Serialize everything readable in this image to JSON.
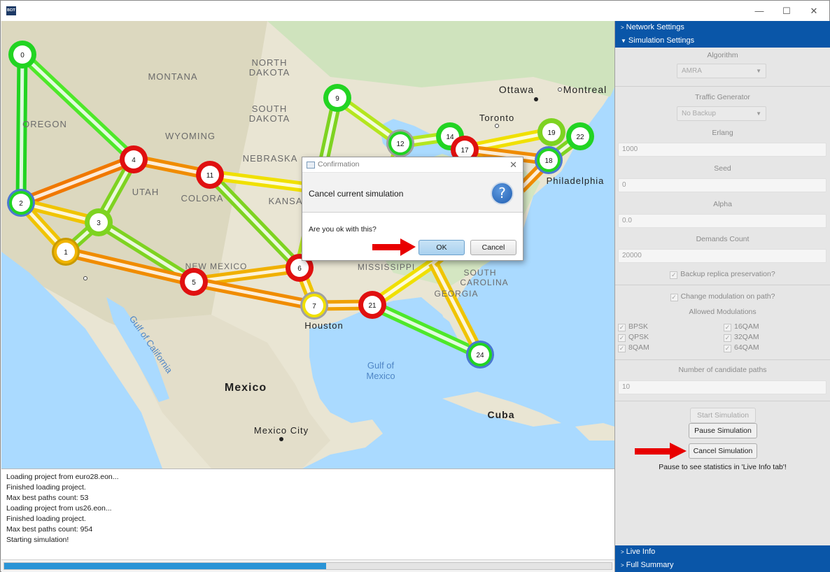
{
  "window": {
    "app_icon_text": "BCIT",
    "minimize": "—",
    "maximize": "☐",
    "close": "✕"
  },
  "map": {
    "place_labels": [
      {
        "text": "NORTH",
        "kind": "state"
      },
      {
        "text": "DAKOTA",
        "kind": "state"
      },
      {
        "text": "MONTANA",
        "kind": "state"
      },
      {
        "text": "SOUTH",
        "kind": "state"
      },
      {
        "text": "DAKOTA",
        "kind": "state"
      },
      {
        "text": "WYOMING",
        "kind": "state"
      },
      {
        "text": "OREGON",
        "kind": "state"
      },
      {
        "text": "NEBRASKA",
        "kind": "state"
      },
      {
        "text": "UTAH",
        "kind": "state"
      },
      {
        "text": "COLORA",
        "kind": "state"
      },
      {
        "text": "KANSA",
        "kind": "state"
      },
      {
        "text": "NEW MEXICO",
        "kind": "state"
      },
      {
        "text": "MISSISSIPPI",
        "kind": "state"
      },
      {
        "text": "SOUTH",
        "kind": "state"
      },
      {
        "text": "CAROLINA",
        "kind": "state"
      },
      {
        "text": "GEORGIA",
        "kind": "state"
      },
      {
        "text": "Ottawa",
        "kind": "city"
      },
      {
        "text": "Montreal",
        "kind": "city"
      },
      {
        "text": "Toronto",
        "kind": "city"
      },
      {
        "text": "Philadelphia",
        "kind": "city"
      },
      {
        "text": "Houston",
        "kind": "city"
      },
      {
        "text": "Mexico",
        "kind": "country"
      },
      {
        "text": "Mexico City",
        "kind": "city"
      },
      {
        "text": "Cuba",
        "kind": "country"
      },
      {
        "text": "Gulf of",
        "kind": "water"
      },
      {
        "text": "Mexico",
        "kind": "water"
      },
      {
        "text": "Gulf of California",
        "kind": "water"
      }
    ],
    "nodes": [
      {
        "id": "0",
        "ring": "#22d422"
      },
      {
        "id": "1",
        "ring": "#f0b400"
      },
      {
        "id": "2",
        "ring": "#22d422"
      },
      {
        "id": "3",
        "ring": "#7ed321"
      },
      {
        "id": "4",
        "ring": "#e01010"
      },
      {
        "id": "5",
        "ring": "#e01010"
      },
      {
        "id": "6",
        "ring": "#e01010"
      },
      {
        "id": "7",
        "ring": "#f0e000"
      },
      {
        "id": "9",
        "ring": "#22d422"
      },
      {
        "id": "11",
        "ring": "#e01010"
      },
      {
        "id": "12",
        "ring": "#22d422"
      },
      {
        "id": "14",
        "ring": "#22d422"
      },
      {
        "id": "17",
        "ring": "#e01010"
      },
      {
        "id": "18",
        "ring": "#22d422"
      },
      {
        "id": "19",
        "ring": "#7ed321"
      },
      {
        "id": "21",
        "ring": "#e01010"
      },
      {
        "id": "22",
        "ring": "#22d422"
      },
      {
        "id": "24",
        "ring": "#22d422"
      }
    ]
  },
  "log": {
    "lines": [
      "Loading project from euro28.eon...",
      "Finished loading project.",
      "Max best paths count: 53",
      "Loading project from us26.eon...",
      "Finished loading project.",
      "Max best paths count: 954",
      "Starting simulation!"
    ]
  },
  "progress": {
    "fraction": 0.53,
    "color": "#2a94d6"
  },
  "sidebar": {
    "network_settings": "Network Settings",
    "simulation_settings": "Simulation Settings",
    "algorithm_label": "Algorithm",
    "algorithm_value": "AMRA",
    "traffic_label": "Traffic Generator",
    "traffic_value": "No Backup",
    "erlang_label": "Erlang",
    "erlang_value": "1000",
    "seed_label": "Seed",
    "seed_value": "0",
    "alpha_label": "Alpha",
    "alpha_value": "0.0",
    "demands_label": "Demands Count",
    "demands_value": "20000",
    "backup_label": "Backup replica preservation?",
    "modulation_label": "Change modulation on path?",
    "allowed_label": "Allowed Modulations",
    "modulations": [
      "BPSK",
      "QPSK",
      "8QAM",
      "16QAM",
      "32QAM",
      "64QAM"
    ],
    "candidate_label": "Number of candidate paths",
    "candidate_value": "10",
    "start_button": "Start Simulation",
    "pause_button": "Pause Simulation",
    "cancel_button": "Cancel Simulation",
    "pause_note": "Pause to see statistics in 'Live Info tab'!",
    "live_info": "Live Info",
    "full_summary": "Full Summary",
    "accent": "#0a56a8"
  },
  "dialog": {
    "title": "Confirmation",
    "header": "Cancel current simulation",
    "question_glyph": "?",
    "body": "Are you ok with this?",
    "ok": "OK",
    "cancel": "Cancel",
    "close": "✕"
  }
}
